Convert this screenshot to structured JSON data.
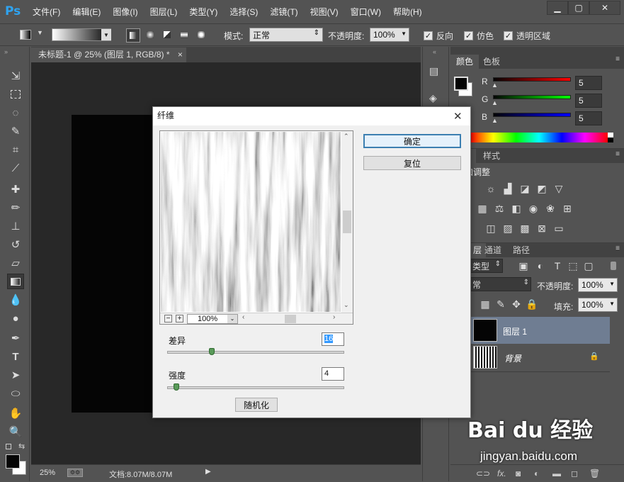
{
  "app": {
    "logo": "Ps",
    "menus": [
      "文件(F)",
      "编辑(E)",
      "图像(I)",
      "图层(L)",
      "类型(Y)",
      "选择(S)",
      "滤镜(T)",
      "视图(V)",
      "窗口(W)",
      "帮助(H)"
    ],
    "window_buttons": [
      "▁",
      "▢",
      "✕"
    ]
  },
  "options": {
    "mode_label": "模式:",
    "mode_value": "正常",
    "opacity_label": "不透明度:",
    "opacity_value": "100%",
    "reverse_label": "反向",
    "dither_label": "仿色",
    "transparency_label": "透明区域",
    "reverse_checked": true,
    "dither_checked": true,
    "transparency_checked": true
  },
  "document": {
    "tab_title": "未标题-1 @ 25% (图层 1, RGB/8) *",
    "tab_close": "×",
    "zoom": "25%",
    "doc_size": "文档:8.07M/8.07M"
  },
  "color_panel": {
    "tabs": [
      "颜色",
      "色板"
    ],
    "channels": [
      {
        "label": "R",
        "value": "5",
        "color": "#ff0000"
      },
      {
        "label": "G",
        "value": "5",
        "color": "#00ff00"
      },
      {
        "label": "B",
        "value": "5",
        "color": "#0000ff"
      }
    ]
  },
  "adjust_panel": {
    "tabs": [
      "",
      "样式"
    ],
    "title": "加调整"
  },
  "layers_panel": {
    "tabs": [
      "层",
      "通道",
      "路径"
    ],
    "kind_value": "类型",
    "blend_value": "常",
    "opacity_label": "不透明度:",
    "opacity_value": "100%",
    "fill_label": "填充:",
    "fill_value": "100%",
    "layers": [
      {
        "name": "图层 1",
        "selected": true
      },
      {
        "name": "背景",
        "locked": true
      }
    ]
  },
  "dialog": {
    "title": "纤维",
    "close": "✕",
    "ok": "确定",
    "reset": "复位",
    "preview_zoom": "100%",
    "zoom_out": "−",
    "zoom_in": "+",
    "variance_label": "差异",
    "variance_value": "16",
    "strength_label": "强度",
    "strength_value": "4",
    "randomize": "随机化",
    "variance_fraction": 0.25,
    "strength_fraction": 0.05
  },
  "watermark": {
    "brand": "Bai du 经验",
    "url": "jingyan.baidu.com"
  }
}
